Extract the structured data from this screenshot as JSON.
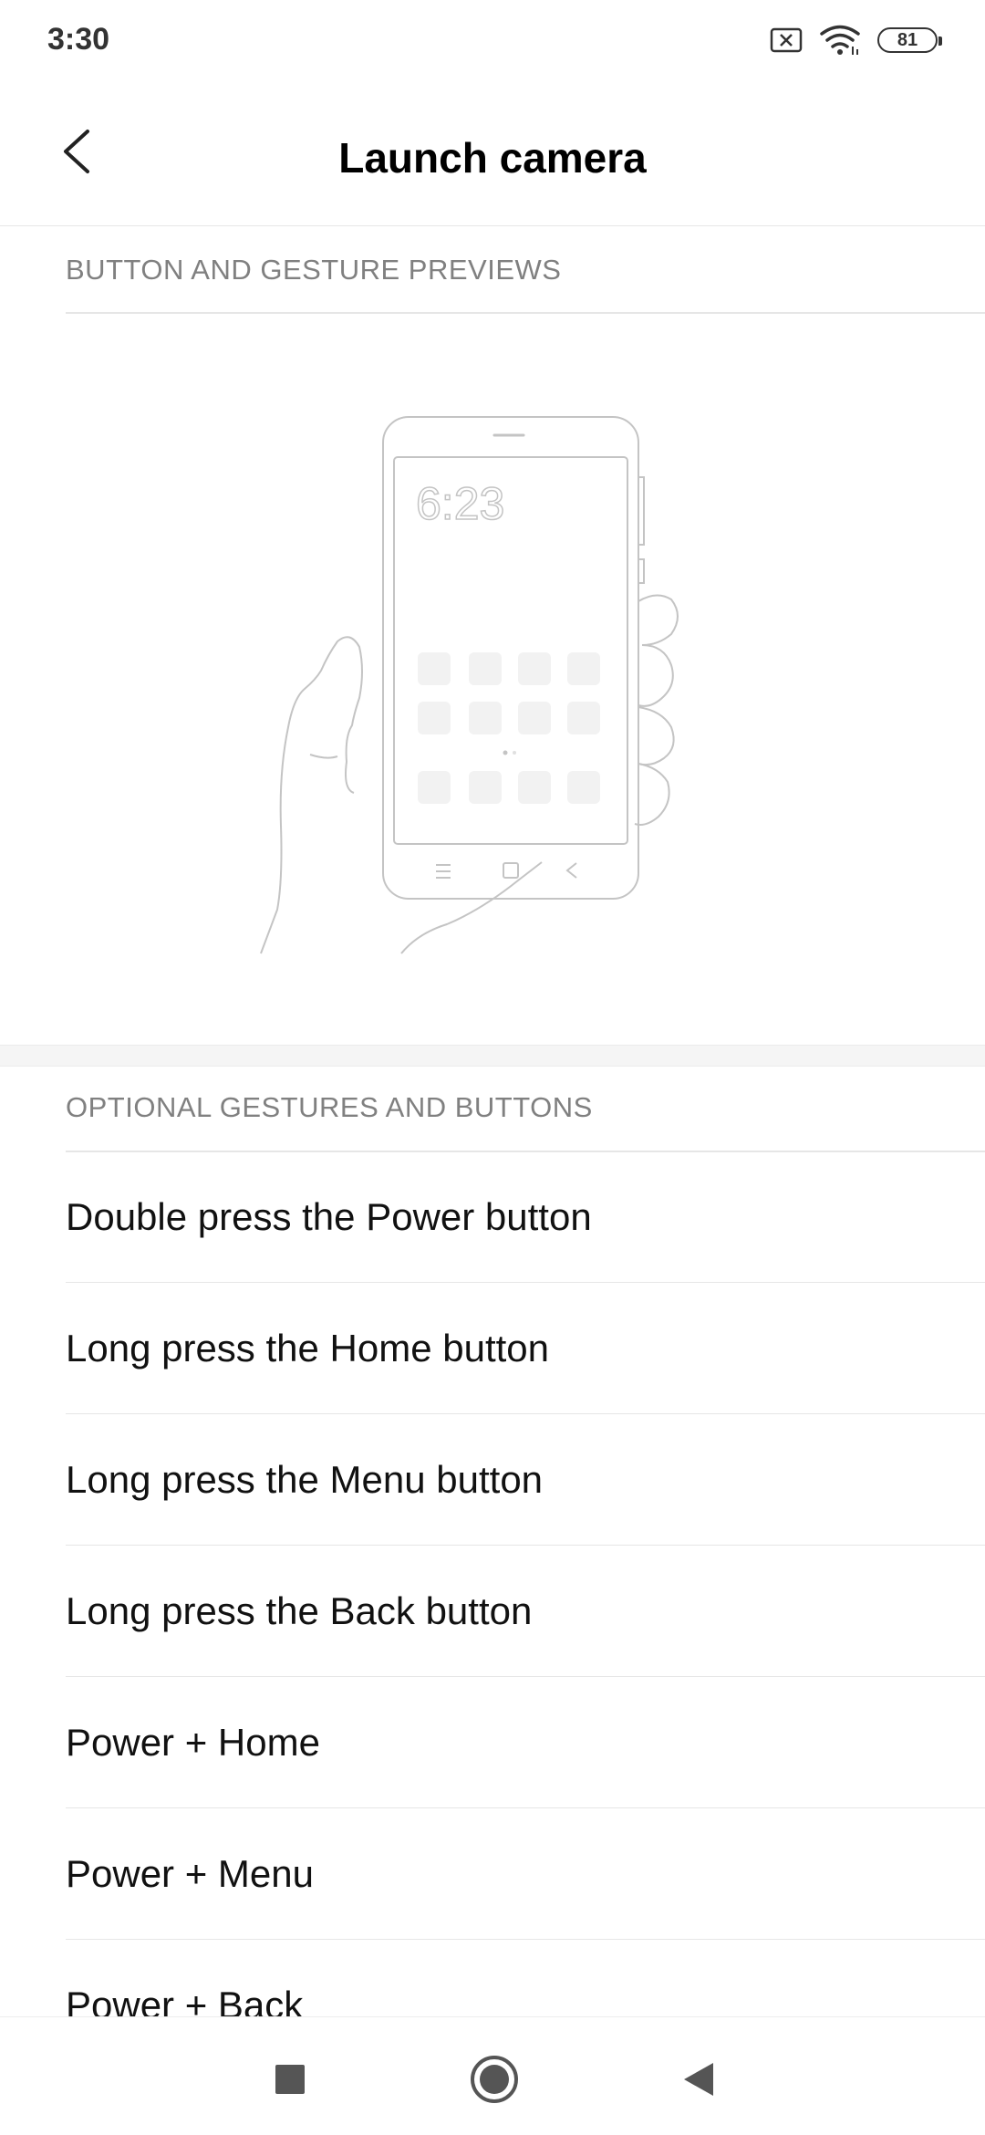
{
  "status_bar": {
    "time": "3:30",
    "battery": "81",
    "icons": [
      "sim-off-icon",
      "wifi-icon",
      "battery-icon"
    ]
  },
  "header": {
    "title": "Launch camera",
    "back_icon": "chevron-left-icon"
  },
  "sections": {
    "previews_label": "BUTTON AND GESTURE PREVIEWS",
    "optional_label": "OPTIONAL GESTURES AND BUTTONS"
  },
  "preview": {
    "clock": "6:23"
  },
  "options": [
    "Double press the Power button",
    "Long press the Home button",
    "Long press the Menu button",
    "Long press the Back button",
    "Power + Home",
    "Power + Menu",
    "Power + Back"
  ],
  "nav_bar": {
    "icons": [
      "recents-square-icon",
      "home-circle-icon",
      "back-triangle-icon"
    ]
  },
  "colors": {
    "section_label": "#808080",
    "divider": "#e6e6e6",
    "illustration_stroke": "#bdbdbd"
  }
}
